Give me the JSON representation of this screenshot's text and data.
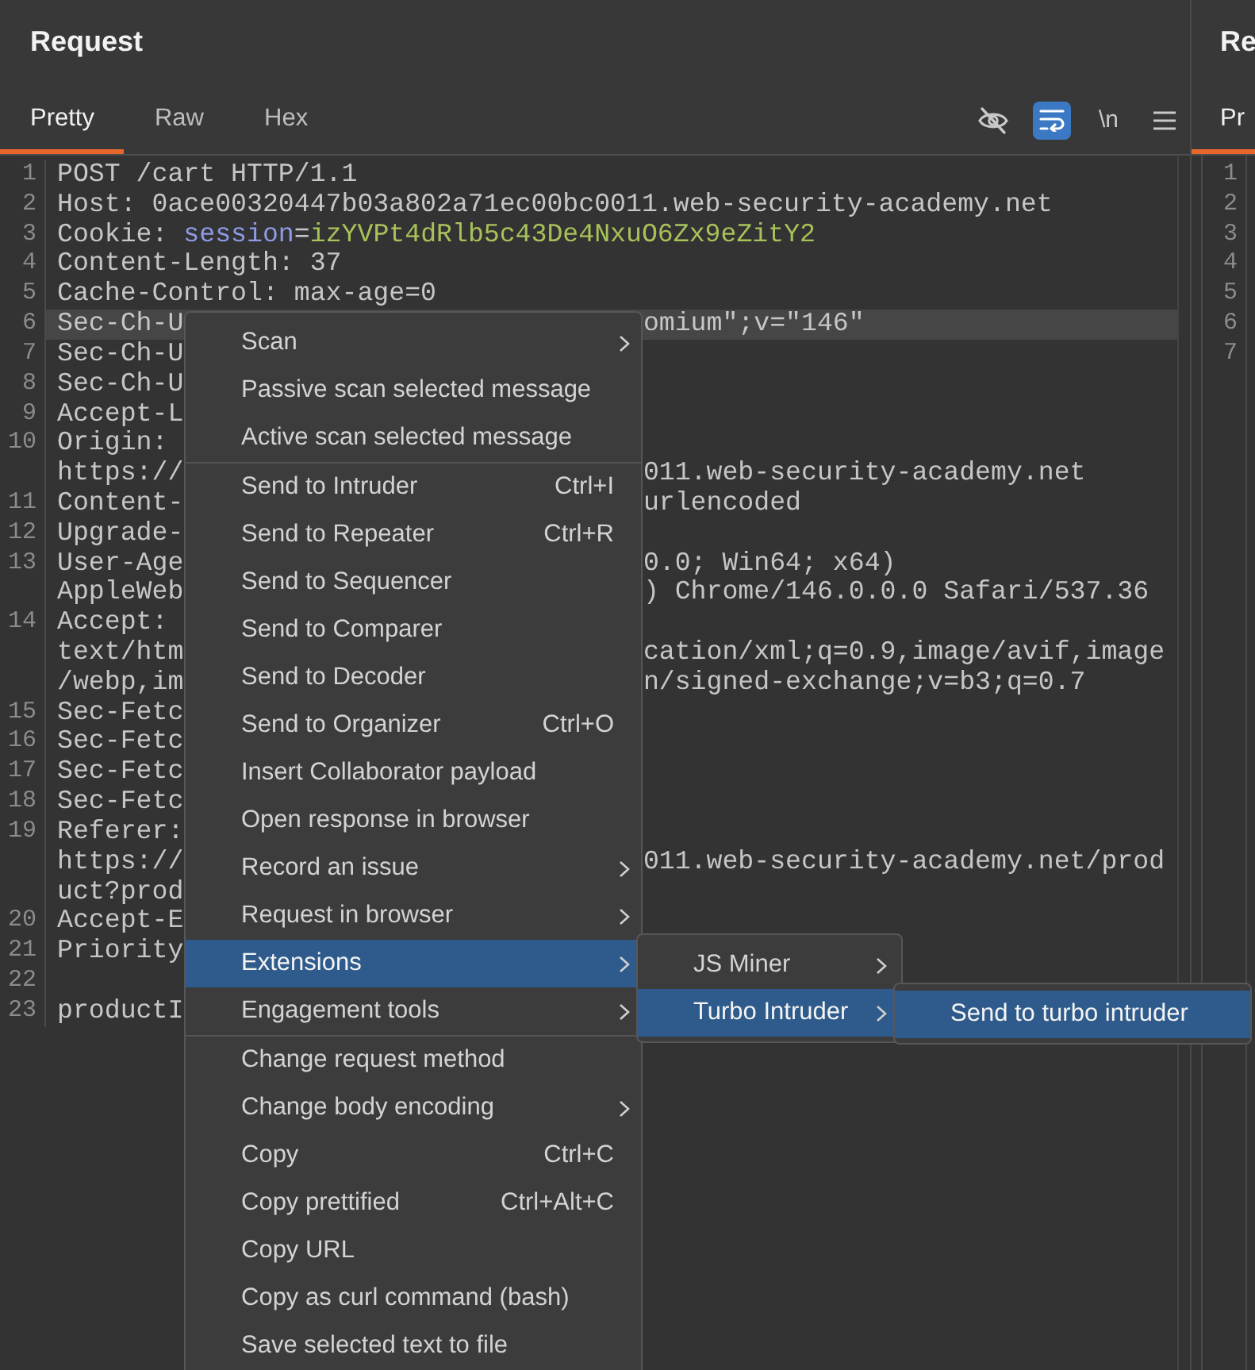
{
  "request_panel": {
    "title": "Request",
    "tabs": [
      {
        "label": "Pretty",
        "selected": true
      },
      {
        "label": "Raw",
        "selected": false
      },
      {
        "label": "Hex",
        "selected": false
      }
    ],
    "toolbar": [
      {
        "kind": "hide",
        "on": false
      },
      {
        "kind": "wrap",
        "on": true
      },
      {
        "kind": "newline",
        "label": "\\n",
        "on": false
      },
      {
        "kind": "menu"
      }
    ],
    "rows": [
      {
        "number": "1",
        "text": "POST /cart HTTP/1.1",
        "current": false
      },
      {
        "number": "2",
        "text": "Host: 0ace00320447b03a802a71ec00bc0011.web-security-academy.net",
        "current": false
      },
      {
        "number": "3",
        "parts": [
          {
            "kind": "plain",
            "text": "Cookie: "
          },
          {
            "kind": "name",
            "text": "session"
          },
          {
            "kind": "plain",
            "text": "="
          },
          {
            "kind": "value",
            "text": "izYVPt4dRlb5c43De4NxuO6Zx9eZitY2"
          }
        ],
        "current": false
      },
      {
        "number": "4",
        "text": "Content-Length: 37",
        "current": false
      },
      {
        "number": "5",
        "text": "Cache-Control: max-age=0",
        "current": false
      },
      {
        "number": "6",
        "text": "Sec-Ch-U",
        "tail": "omium\";v=\"146\"",
        "current": true
      },
      {
        "number": "7",
        "text": "Sec-Ch-U",
        "current": false
      },
      {
        "number": "8",
        "text": "Sec-Ch-U",
        "current": false
      },
      {
        "number": "9",
        "text": "Accept-L",
        "current": false
      },
      {
        "number": "10",
        "text": "Origin:",
        "current": false
      },
      {
        "text": "https://",
        "tail": "011.web-security-academy.net",
        "current": false
      },
      {
        "number": "11",
        "text": "Content-",
        "tail": "urlencoded",
        "current": false
      },
      {
        "number": "12",
        "text": "Upgrade-",
        "current": false
      },
      {
        "number": "13",
        "text": "User-Age",
        "tail": "0.0; Win64; x64)",
        "current": false
      },
      {
        "text": "AppleWeb",
        "tail": ") Chrome/146.0.0.0 Safari/537.36",
        "current": false
      },
      {
        "number": "14",
        "text": "Accept:",
        "current": false
      },
      {
        "text": "text/htm",
        "tail": "cation/xml;q=0.9,image/avif,image",
        "current": false
      },
      {
        "text": "/webp,im",
        "tail": "n/signed-exchange;v=b3;q=0.7",
        "current": false
      },
      {
        "number": "15",
        "text": "Sec-Fetc",
        "current": false
      },
      {
        "number": "16",
        "text": "Sec-Fetc",
        "current": false
      },
      {
        "number": "17",
        "text": "Sec-Fetc",
        "current": false
      },
      {
        "number": "18",
        "text": "Sec-Fetc",
        "current": false
      },
      {
        "number": "19",
        "text": "Referer:",
        "current": false
      },
      {
        "text": "https://",
        "tail": "011.web-security-academy.net/prod",
        "current": false
      },
      {
        "text": "uct?prod",
        "current": false
      },
      {
        "number": "20",
        "text": "Accept-E",
        "current": false
      },
      {
        "number": "21",
        "text": "Priority",
        "current": false
      },
      {
        "number": "22",
        "current": false
      },
      {
        "number": "23",
        "text": "productI",
        "current": false
      }
    ]
  },
  "response_panel": {
    "title": "Re",
    "tabs": [
      {
        "label": "Pr",
        "selected": true
      }
    ],
    "line_numbers": [
      "1",
      "2",
      "3",
      "4",
      "5",
      "6",
      "7"
    ]
  },
  "context_menu": {
    "sections": [
      {
        "items": [
          {
            "label": "Scan",
            "submenu": true,
            "selected": false
          },
          {
            "label": "Passive scan selected message",
            "submenu": false,
            "selected": false
          },
          {
            "label": "Active scan selected message",
            "submenu": false,
            "selected": false
          }
        ]
      },
      {
        "items": [
          {
            "label": "Send to Intruder",
            "shortcut": "Ctrl+I",
            "submenu": false,
            "selected": false
          },
          {
            "label": "Send to Repeater",
            "shortcut": "Ctrl+R",
            "submenu": false,
            "selected": false
          },
          {
            "label": "Send to Sequencer",
            "submenu": false,
            "selected": false
          },
          {
            "label": "Send to Comparer",
            "submenu": false,
            "selected": false
          },
          {
            "label": "Send to Decoder",
            "submenu": false,
            "selected": false
          },
          {
            "label": "Send to Organizer",
            "shortcut": "Ctrl+O",
            "submenu": false,
            "selected": false
          },
          {
            "label": "Insert Collaborator payload",
            "submenu": false,
            "selected": false
          },
          {
            "label": "Open response in browser",
            "submenu": false,
            "selected": false
          },
          {
            "label": "Record an issue",
            "submenu": true,
            "selected": false
          },
          {
            "label": "Request in browser",
            "submenu": true,
            "selected": false
          },
          {
            "label": "Extensions",
            "submenu": true,
            "selected": true
          },
          {
            "label": "Engagement tools",
            "submenu": true,
            "selected": false
          }
        ]
      },
      {
        "items": [
          {
            "label": "Change request method",
            "submenu": false,
            "selected": false
          },
          {
            "label": "Change body encoding",
            "submenu": true,
            "selected": false
          },
          {
            "label": "Copy",
            "shortcut": "Ctrl+C",
            "submenu": false,
            "selected": false
          },
          {
            "label": "Copy prettified",
            "shortcut": "Ctrl+Alt+C",
            "submenu": false,
            "selected": false
          },
          {
            "label": "Copy URL",
            "submenu": false,
            "selected": false
          },
          {
            "label": "Copy as curl command (bash)",
            "submenu": false,
            "selected": false
          },
          {
            "label": "Save selected text to file",
            "submenu": false,
            "selected": false
          }
        ]
      }
    ]
  },
  "extensions_menu": {
    "items": [
      {
        "label": "JS Miner",
        "submenu": true,
        "selected": false
      },
      {
        "label": "Turbo Intruder",
        "submenu": true,
        "selected": true
      }
    ]
  },
  "turbo_intruder_menu": {
    "items": [
      {
        "label": "Send to turbo intruder",
        "submenu": false,
        "selected": true
      }
    ]
  }
}
